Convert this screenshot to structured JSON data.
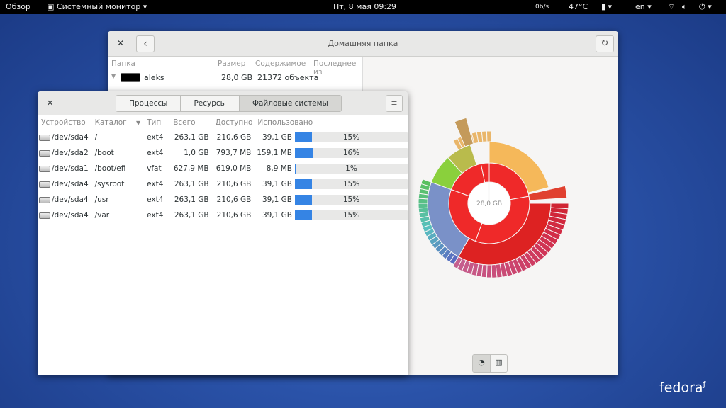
{
  "topbar": {
    "overview": "Обзор",
    "app": "Системный монитор",
    "clock": "Пт, 8 мая  09:29",
    "net": "0b/s",
    "temp": "47°C",
    "lang": "en"
  },
  "baobab": {
    "title": "Домашняя папка",
    "columns": [
      "Папка",
      "Размер",
      "Содержимое",
      "Последнее из"
    ],
    "rows": [
      {
        "name": "aleks",
        "size": "28,0 GB",
        "contents": "21372 объекта"
      }
    ],
    "center_label": "28,0 GB"
  },
  "sysmon": {
    "tabs": [
      "Процессы",
      "Ресурсы",
      "Файловые системы"
    ],
    "columns": [
      "Устройство",
      "Каталог",
      "Тип",
      "Всего",
      "Доступно",
      "Использовано"
    ],
    "rows": [
      {
        "device": "/dev/sda4",
        "dir": "/",
        "type": "ext4",
        "total": "263,1 GB",
        "free": "210,6 GB",
        "used": "39,1 GB",
        "pct": 15,
        "pct_label": "15%"
      },
      {
        "device": "/dev/sda2",
        "dir": "/boot",
        "type": "ext4",
        "total": "1,0 GB",
        "free": "793,7 MB",
        "used": "159,1 MB",
        "pct": 16,
        "pct_label": "16%"
      },
      {
        "device": "/dev/sda1",
        "dir": "/boot/efi",
        "type": "vfat",
        "total": "627,9 MB",
        "free": "619,0 MB",
        "used": "8,9 MB",
        "pct": 1,
        "pct_label": "1%"
      },
      {
        "device": "/dev/sda4",
        "dir": "/sysroot",
        "type": "ext4",
        "total": "263,1 GB",
        "free": "210,6 GB",
        "used": "39,1 GB",
        "pct": 15,
        "pct_label": "15%"
      },
      {
        "device": "/dev/sda4",
        "dir": "/usr",
        "type": "ext4",
        "total": "263,1 GB",
        "free": "210,6 GB",
        "used": "39,1 GB",
        "pct": 15,
        "pct_label": "15%"
      },
      {
        "device": "/dev/sda4",
        "dir": "/var",
        "type": "ext4",
        "total": "263,1 GB",
        "free": "210,6 GB",
        "used": "39,1 GB",
        "pct": 15,
        "pct_label": "15%"
      }
    ]
  },
  "brand": "fedora"
}
